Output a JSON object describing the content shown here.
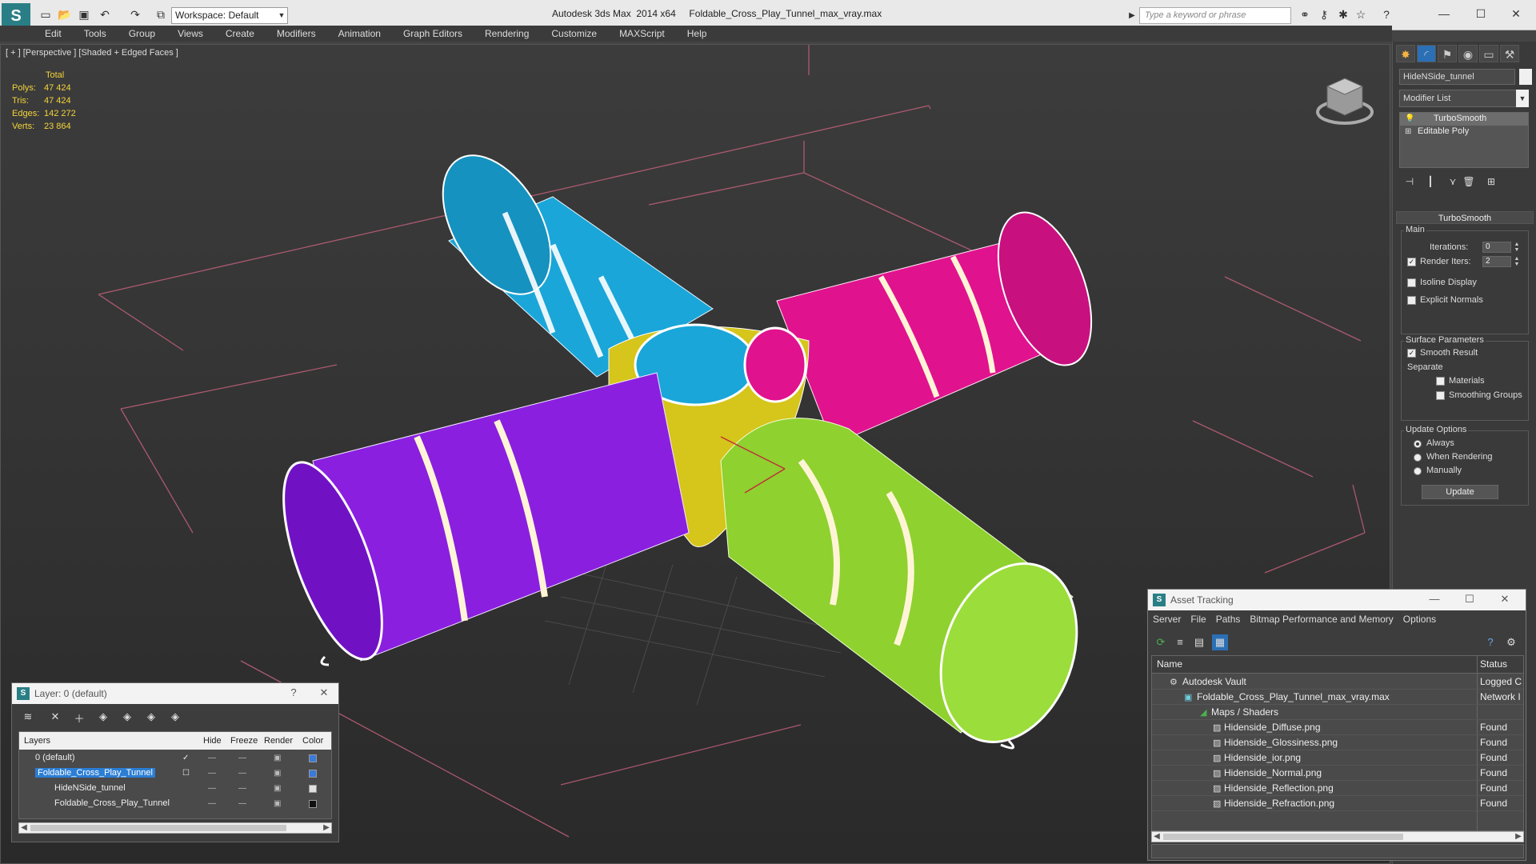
{
  "titlebar": {
    "workspace": "Workspace: Default",
    "title": "Autodesk 3ds Max  2014 x64     Foldable_Cross_Play_Tunnel_max_vray.max",
    "search_placeholder": "Type a keyword or phrase"
  },
  "menu": [
    "Edit",
    "Tools",
    "Group",
    "Views",
    "Create",
    "Modifiers",
    "Animation",
    "Graph Editors",
    "Rendering",
    "Customize",
    "MAXScript",
    "Help"
  ],
  "viewport": {
    "label": "[ + ] [Perspective ] [Shaded + Edged Faces ]",
    "stats_header": "Total",
    "stats": [
      {
        "label": "Polys:",
        "value": "47 424"
      },
      {
        "label": "Tris:",
        "value": "47 424"
      },
      {
        "label": "Edges:",
        "value": "142 272"
      },
      {
        "label": "Verts:",
        "value": "23 864"
      }
    ],
    "tube_colors": {
      "blue": "#1aa6d8",
      "magenta": "#e0128e",
      "purple": "#8a1fe0",
      "green": "#8fd12e",
      "yellow": "#d6c51b"
    }
  },
  "command_panel": {
    "object_name": "HideNSide_tunnel",
    "modifier_list": "Modifier List",
    "stack": [
      "TurboSmooth",
      "Editable Poly"
    ],
    "rollout_title": "TurboSmooth",
    "main_group": "Main",
    "iterations_label": "Iterations:",
    "iterations_value": "0",
    "render_iters_label": "Render Iters:",
    "render_iters_value": "2",
    "isoline_label": "Isoline Display",
    "explicit_normals_label": "Explicit Normals",
    "surface_group": "Surface Parameters",
    "smooth_result_label": "Smooth Result",
    "separate_label": "Separate",
    "materials_label": "Materials",
    "smoothing_groups_label": "Smoothing Groups",
    "update_group": "Update Options",
    "always_label": "Always",
    "when_rendering_label": "When Rendering",
    "manually_label": "Manually",
    "update_button": "Update"
  },
  "layer_dialog": {
    "title": "Layer: 0 (default)",
    "help": "?",
    "headers": {
      "layers": "Layers",
      "hide": "Hide",
      "freeze": "Freeze",
      "render": "Render",
      "color": "Color"
    },
    "rows": [
      {
        "name": "0 (default)",
        "color": "#3a7ad8"
      },
      {
        "name": "Foldable_Cross_Play_Tunnel",
        "color": "#3a7ad8"
      },
      {
        "name": "HideNSide_tunnel",
        "color": "#e0e0e0"
      },
      {
        "name": "Foldable_Cross_Play_Tunnel",
        "color": "#111111"
      }
    ]
  },
  "asset_dialog": {
    "title": "Asset Tracking",
    "menu": [
      "Server",
      "File",
      "Paths",
      "Bitmap Performance and Memory",
      "Options"
    ],
    "headers": {
      "name": "Name",
      "status": "Status"
    },
    "rows": [
      {
        "name": "Autodesk Vault",
        "status": "Logged C"
      },
      {
        "name": "Foldable_Cross_Play_Tunnel_max_vray.max",
        "status": "Network I"
      },
      {
        "name": "Maps / Shaders",
        "status": ""
      },
      {
        "name": "Hidenside_Diffuse.png",
        "status": "Found"
      },
      {
        "name": "Hidenside_Glossiness.png",
        "status": "Found"
      },
      {
        "name": "Hidenside_ior.png",
        "status": "Found"
      },
      {
        "name": "Hidenside_Normal.png",
        "status": "Found"
      },
      {
        "name": "Hidenside_Reflection.png",
        "status": "Found"
      },
      {
        "name": "Hidenside_Refraction.png",
        "status": "Found"
      }
    ]
  }
}
